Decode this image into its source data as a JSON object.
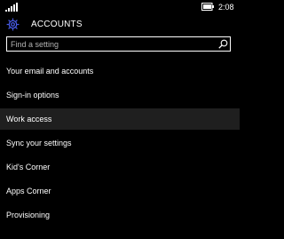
{
  "status_bar": {
    "signal_icon": "signal-strength-icon",
    "battery_icon": "battery-icon",
    "time": "2:08"
  },
  "header": {
    "icon": "gear-icon",
    "title": "ACCOUNTS"
  },
  "search": {
    "placeholder": "Find a setting",
    "icon": "search-icon"
  },
  "menu": {
    "items": [
      {
        "label": "Your email and accounts"
      },
      {
        "label": "Sign-in options"
      },
      {
        "label": "Work access"
      },
      {
        "label": "Sync your settings"
      },
      {
        "label": "Kid's Corner"
      },
      {
        "label": "Apps Corner"
      },
      {
        "label": "Provisioning"
      }
    ],
    "selected_item": "Work access"
  },
  "colors": {
    "background": "#000000",
    "text": "#ffffff",
    "placeholder": "#b3b3b3",
    "selected_row": "#1f1f1f",
    "accent": "#4a5ff0"
  }
}
